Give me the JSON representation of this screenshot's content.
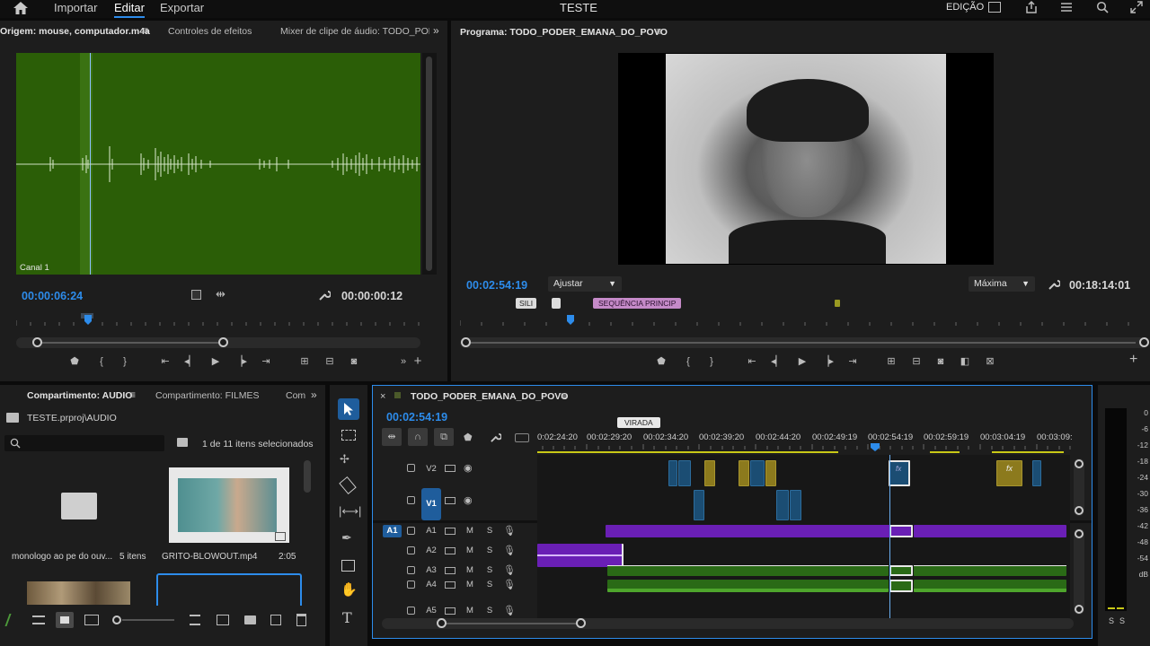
{
  "app": {
    "title": "TESTE",
    "menu": [
      "Importar",
      "Editar",
      "Exportar"
    ],
    "workspace": "EDIÇÃO"
  },
  "source_monitor": {
    "tabs": [
      "Origem: mouse, computador.m4a",
      "Controles de efeitos",
      "Mixer de clipe de áudio: TODO_PODE"
    ],
    "channel": "Canal 1",
    "timecode_in": "00:00:06:24",
    "timecode_dur": "00:00:00:12",
    "waveform_color": "#2b5e07"
  },
  "program_monitor": {
    "title": "Programa: TODO_PODER_EMANA_DO_POVO",
    "timecode": "00:02:54:19",
    "fit": "Ajustar",
    "quality": "Máxima",
    "duration": "00:18:14:01",
    "markers": [
      "SILI",
      "SEQUÊNCIA PRINCIP"
    ]
  },
  "project": {
    "tabs": [
      "Compartimento: AUDIO",
      "Compartimento: FILMES",
      "Com"
    ],
    "path": "TESTE.prproj\\AUDIO",
    "selection": "1 de 11 itens selecionados",
    "search_placeholder": "",
    "items": [
      {
        "name": "monologo ao pe do ouv...",
        "meta": "5 itens"
      },
      {
        "name": "GRITO-BLOWOUT.mp4",
        "meta": "2:05"
      }
    ]
  },
  "timeline": {
    "title": "TODO_PODER_EMANA_DO_POVO",
    "timecode": "00:02:54:19",
    "marker": "VIRADA",
    "ruler": [
      "0:02:24:20",
      "00:02:29:20",
      "00:02:34:20",
      "00:02:39:20",
      "00:02:44:20",
      "00:02:49:19",
      "00:02:54:19",
      "00:02:59:19",
      "00:03:04:19",
      "00:03:09:"
    ],
    "video_tracks": [
      "V2",
      "V1"
    ],
    "audio_tracks": [
      "A1",
      "A2",
      "A3",
      "A4",
      "A5"
    ],
    "mute": "M",
    "solo": "S",
    "fx": "fx"
  },
  "meters": {
    "scale": [
      "0",
      "-6",
      "-12",
      "-18",
      "-24",
      "-30",
      "-36",
      "-42",
      "-48",
      "-54",
      "dB"
    ],
    "solo": "S"
  }
}
